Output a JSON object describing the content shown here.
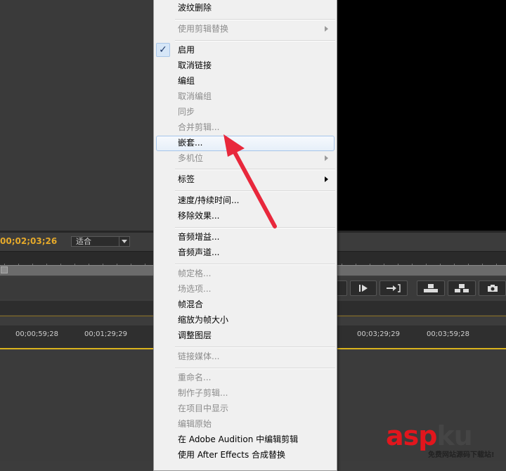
{
  "timecode": "00;02;03;26",
  "fit_dropdown": {
    "value": "适合"
  },
  "timeline_timecodes": [
    "00;00;59;28",
    "00;01;29;29",
    "00;03;29;29",
    "00;03;59;28"
  ],
  "context_menu": {
    "items": [
      {
        "label": "波纹删除",
        "enabled": true
      },
      {
        "label": "使用剪辑替换",
        "enabled": false,
        "submenu": true
      },
      {
        "label": "启用",
        "enabled": true,
        "checked": true
      },
      {
        "label": "取消链接",
        "enabled": true
      },
      {
        "label": "编组",
        "enabled": true
      },
      {
        "label": "取消编组",
        "enabled": false
      },
      {
        "label": "同步",
        "enabled": false
      },
      {
        "label": "合并剪辑...",
        "enabled": false
      },
      {
        "label": "嵌套...",
        "enabled": true,
        "highlighted": true
      },
      {
        "label": "多机位",
        "enabled": false,
        "submenu": true
      },
      {
        "label": "标签",
        "enabled": true,
        "submenu": true
      },
      {
        "label": "速度/持续时间...",
        "enabled": true
      },
      {
        "label": "移除效果...",
        "enabled": true
      },
      {
        "label": "音频增益...",
        "enabled": true
      },
      {
        "label": "音频声道...",
        "enabled": true
      },
      {
        "label": "帧定格...",
        "enabled": false
      },
      {
        "label": "场选项...",
        "enabled": false
      },
      {
        "label": "帧混合",
        "enabled": true
      },
      {
        "label": "缩放为帧大小",
        "enabled": true
      },
      {
        "label": "调整图层",
        "enabled": true
      },
      {
        "label": "链接媒体...",
        "enabled": false
      },
      {
        "label": "重命名...",
        "enabled": false
      },
      {
        "label": "制作子剪辑...",
        "enabled": false
      },
      {
        "label": "在项目中显示",
        "enabled": false
      },
      {
        "label": "编辑原始",
        "enabled": false
      },
      {
        "label": "在 Adobe Audition 中编辑剪辑",
        "enabled": true
      },
      {
        "label": "使用 After Effects 合成替换",
        "enabled": true
      }
    ]
  },
  "transport_icons": [
    "step-forward-icon",
    "go-to-out-icon",
    "lift-icon",
    "extract-icon",
    "export-frame-icon"
  ],
  "watermark": {
    "brand_asp": "asp",
    "brand_ku": "ku",
    "tagline": "免费网站源码下载站!"
  },
  "colors": {
    "timecode": "#e5a92a",
    "highlight_border": "#a6c5ea",
    "annotation_arrow": "#e8283c"
  }
}
